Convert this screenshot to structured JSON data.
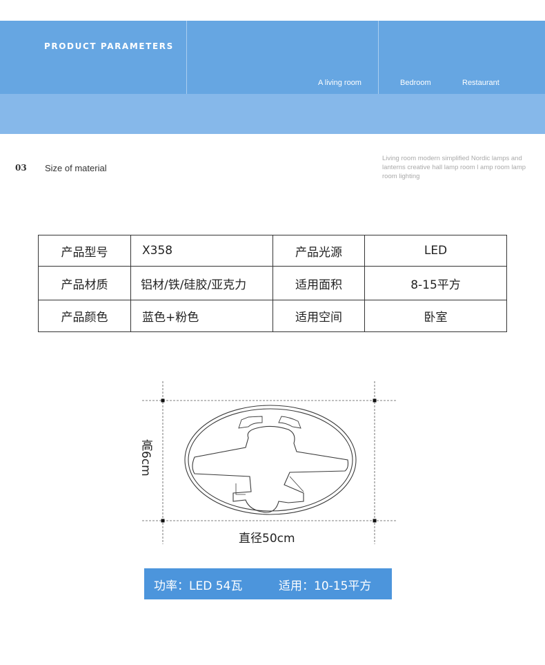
{
  "banner": {
    "title": "PRODUCT PARAMETERS",
    "tabs": [
      "A living room",
      "Bedroom",
      "Restaurant"
    ]
  },
  "section": {
    "number": "03",
    "title": "Size of material",
    "description": "Living room modern simplified Nordic lamps and lanterns creative hall lamp room l amp room lamp room lighting"
  },
  "params": [
    [
      "产品型号",
      "X358",
      "产品光源",
      "LED"
    ],
    [
      "产品材质",
      "铝材/铁/硅胶/亚克力",
      "适用面积",
      "8-15平方"
    ],
    [
      "产品颜色",
      "蓝色+粉色",
      "适用空间",
      "卧室"
    ]
  ],
  "dimensions": {
    "height_label": "高6cm",
    "diameter_label": "直径50cm"
  },
  "info": {
    "power": "功率：LED 54瓦",
    "area": "适用：10-15平方"
  },
  "colors": {
    "banner_top": "#66a6e2",
    "banner_bottom": "#86b8ea",
    "info_bar": "#4c95dc"
  }
}
